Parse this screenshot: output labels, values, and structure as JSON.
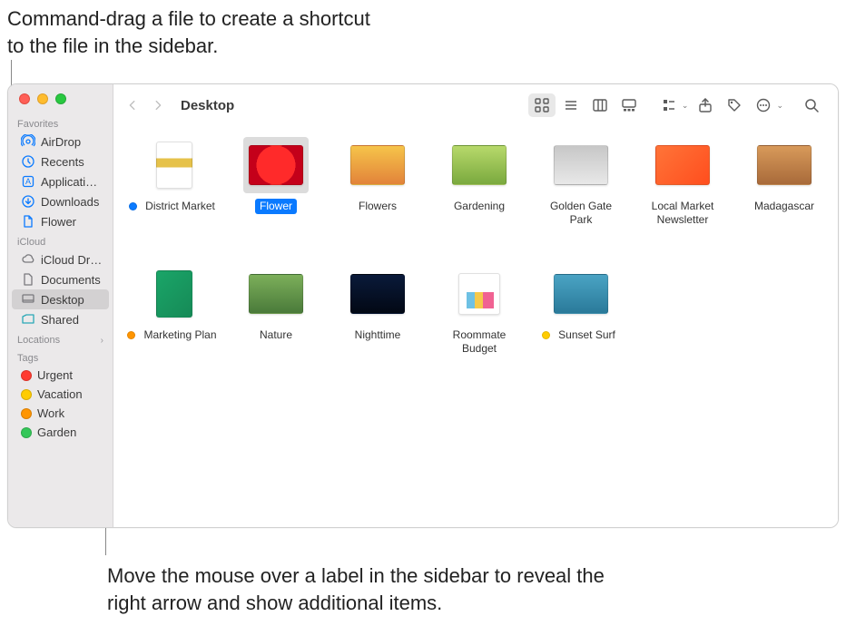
{
  "annotations": {
    "top": "Command-drag a file to create a shortcut to the file in the sidebar.",
    "bottom": "Move the mouse over a label in the sidebar to reveal the right arrow and show additional items."
  },
  "window": {
    "title": "Desktop"
  },
  "sidebar": {
    "sections": {
      "favorites": {
        "label": "Favorites"
      },
      "icloud": {
        "label": "iCloud"
      },
      "locations": {
        "label": "Locations"
      },
      "tags": {
        "label": "Tags"
      }
    },
    "favorites": [
      {
        "label": "AirDrop",
        "icon": "airdrop"
      },
      {
        "label": "Recents",
        "icon": "clock"
      },
      {
        "label": "Applications",
        "icon": "apps"
      },
      {
        "label": "Downloads",
        "icon": "download"
      },
      {
        "label": "Flower",
        "icon": "file"
      }
    ],
    "icloud": [
      {
        "label": "iCloud Drive",
        "icon": "cloud"
      },
      {
        "label": "Documents",
        "icon": "doc"
      },
      {
        "label": "Desktop",
        "icon": "desktop",
        "selected": true
      },
      {
        "label": "Shared",
        "icon": "shared"
      }
    ],
    "tags": [
      {
        "label": "Urgent",
        "color": "#ff3b30"
      },
      {
        "label": "Vacation",
        "color": "#ffcc00"
      },
      {
        "label": "Work",
        "color": "#ff9500"
      },
      {
        "label": "Garden",
        "color": "#34c759"
      }
    ]
  },
  "files": [
    {
      "name": "District Market",
      "thumb": "th-district",
      "shape": "portrait",
      "tag": "#0a7aff"
    },
    {
      "name": "Flower",
      "thumb": "th-flower",
      "shape": "land",
      "selected": true
    },
    {
      "name": "Flowers",
      "thumb": "th-flowers",
      "shape": "land"
    },
    {
      "name": "Gardening",
      "thumb": "th-gardening",
      "shape": "land"
    },
    {
      "name": "Golden Gate Park",
      "thumb": "th-ggp",
      "shape": "land"
    },
    {
      "name": "Local Market Newsletter",
      "thumb": "th-newsletter",
      "shape": "land"
    },
    {
      "name": "Madagascar",
      "thumb": "th-madagascar",
      "shape": "land"
    },
    {
      "name": "Marketing Plan",
      "thumb": "th-marketing",
      "shape": "portrait",
      "tag": "#ff9500"
    },
    {
      "name": "Nature",
      "thumb": "th-nature",
      "shape": "land"
    },
    {
      "name": "Nighttime",
      "thumb": "th-night",
      "shape": "land"
    },
    {
      "name": "Roommate Budget",
      "thumb": "th-roommate",
      "shape": "square"
    },
    {
      "name": "Sunset Surf",
      "thumb": "th-sunset",
      "shape": "land",
      "tag": "#ffcc00"
    }
  ]
}
